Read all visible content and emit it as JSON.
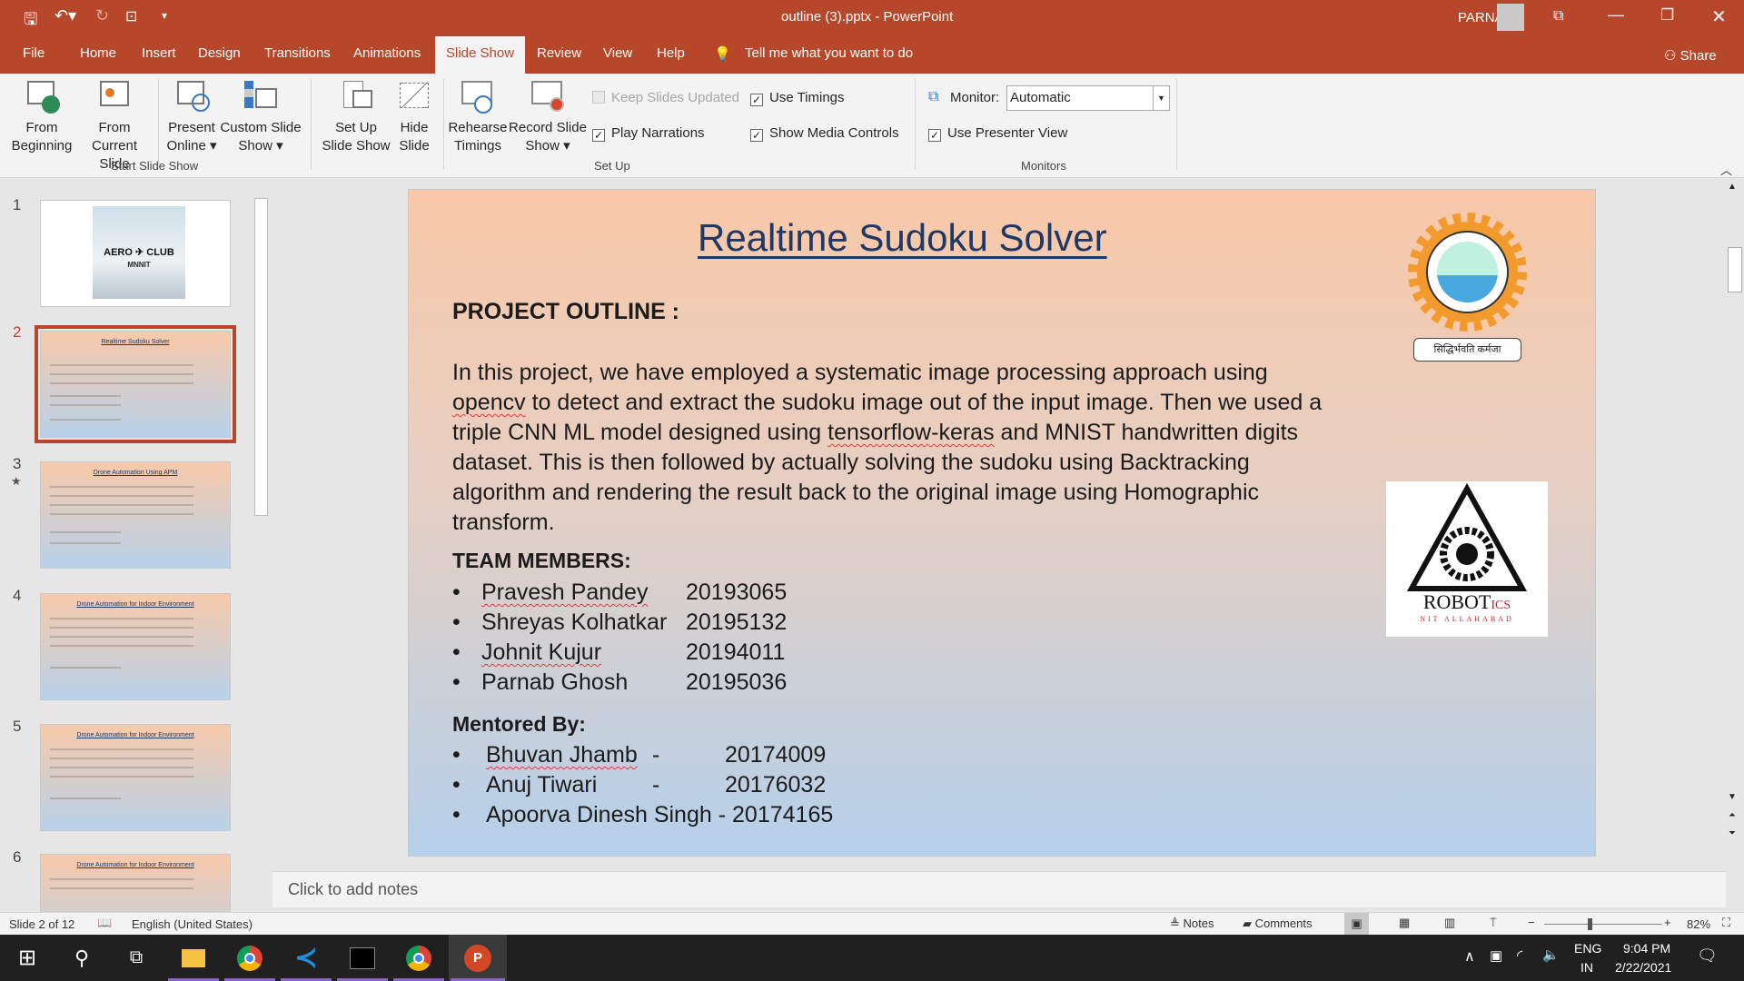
{
  "titlebar": {
    "title": "outline (3).pptx  -  PowerPoint",
    "user": "PARNAB"
  },
  "tabs": [
    "File",
    "Home",
    "Insert",
    "Design",
    "Transitions",
    "Animations",
    "Slide Show",
    "Review",
    "View",
    "Help"
  ],
  "active_tab": "Slide Show",
  "tell_me": "Tell me what you want to do",
  "share": "Share",
  "ribbon": {
    "start": {
      "group": "Start Slide Show",
      "buttons": [
        [
          "From",
          "Beginning"
        ],
        [
          "From",
          "Current Slide"
        ],
        [
          "Present",
          "Online ▾"
        ],
        [
          "Custom Slide",
          "Show ▾"
        ]
      ]
    },
    "setup": {
      "group": "Set Up",
      "buttons": [
        [
          "Set Up",
          "Slide Show"
        ],
        [
          "Hide",
          "Slide"
        ],
        [
          "Rehearse",
          "Timings"
        ],
        [
          "Record Slide",
          "Show ▾"
        ]
      ],
      "checks": [
        {
          "label": "Keep Slides Updated",
          "checked": false,
          "disabled": true
        },
        {
          "label": "Play Narrations",
          "checked": true
        },
        {
          "label": "Use Timings",
          "checked": true
        },
        {
          "label": "Show Media Controls",
          "checked": true
        }
      ]
    },
    "monitors": {
      "group": "Monitors",
      "monitor_label": "Monitor:",
      "monitor_value": "Automatic",
      "presenter": {
        "label": "Use Presenter View",
        "checked": true
      }
    }
  },
  "thumbnails": [
    {
      "num": "1",
      "title": ""
    },
    {
      "num": "2",
      "title": "Realtime Sudoku Solver",
      "selected": true
    },
    {
      "num": "3",
      "title": "Drone Automation Using APM",
      "star": true
    },
    {
      "num": "4",
      "title": "Drone Automation for Indoor Environment"
    },
    {
      "num": "5",
      "title": "Drone Automation for Indoor Environment"
    },
    {
      "num": "6",
      "title": "Drone Automation for Indoor Environment"
    }
  ],
  "slide": {
    "title": "Realtime Sudoku Solver",
    "outline_heading": "PROJECT OUTLINE :",
    "paragraph": [
      "In this project, we have employed a systematic image processing approach using",
      "to detect and extract the sudoku image out of the input image. Then we used a",
      "triple CNN ML model designed using",
      "and MNIST handwritten digits",
      "dataset. This is then followed by actually solving the sudoku using Backtracking",
      "algorithm and rendering the result back to the original image using Homographic",
      "transform."
    ],
    "opencv": "opencv",
    "tfk": "tensorflow-keras",
    "team_heading": "TEAM MEMBERS:",
    "team": [
      {
        "name": "Pravesh Pandey",
        "id": "20193065"
      },
      {
        "name": "Shreyas Kolhatkar",
        "id": "20195132"
      },
      {
        "name": "Johnit Kujur",
        "id": "20194011"
      },
      {
        "name": "Parnab Ghosh",
        "id": "20195036"
      }
    ],
    "mentor_heading": "Mentored By:",
    "mentors": [
      {
        "name": "Bhuvan Jhamb",
        "sep": "-",
        "id": "20174009"
      },
      {
        "name": "Anuj Tiwari",
        "sep": "-",
        "id": "20176032"
      },
      {
        "name": "Apoorva Dinesh Singh",
        "sep": "-",
        "id": "20174165"
      }
    ],
    "logo_nit_text": "सिद्धिर्भवति कर्मजा",
    "logo_robotics_text": "ROBOTICS CLUB NIT ALLAHABAD",
    "logo_aero_text": "AERO CLUB MNNIT"
  },
  "notes_placeholder": "Click to add notes",
  "status": {
    "slide": "Slide 2 of 12",
    "language": "English (United States)",
    "notes": "Notes",
    "comments": "Comments",
    "zoom": "82%"
  },
  "taskbar": {
    "lang1": "ENG",
    "lang2": "IN",
    "time": "9:04 PM",
    "date": "2/22/2021"
  },
  "colors": {
    "accent": "#b7472a",
    "title_blue": "#1f3864"
  }
}
